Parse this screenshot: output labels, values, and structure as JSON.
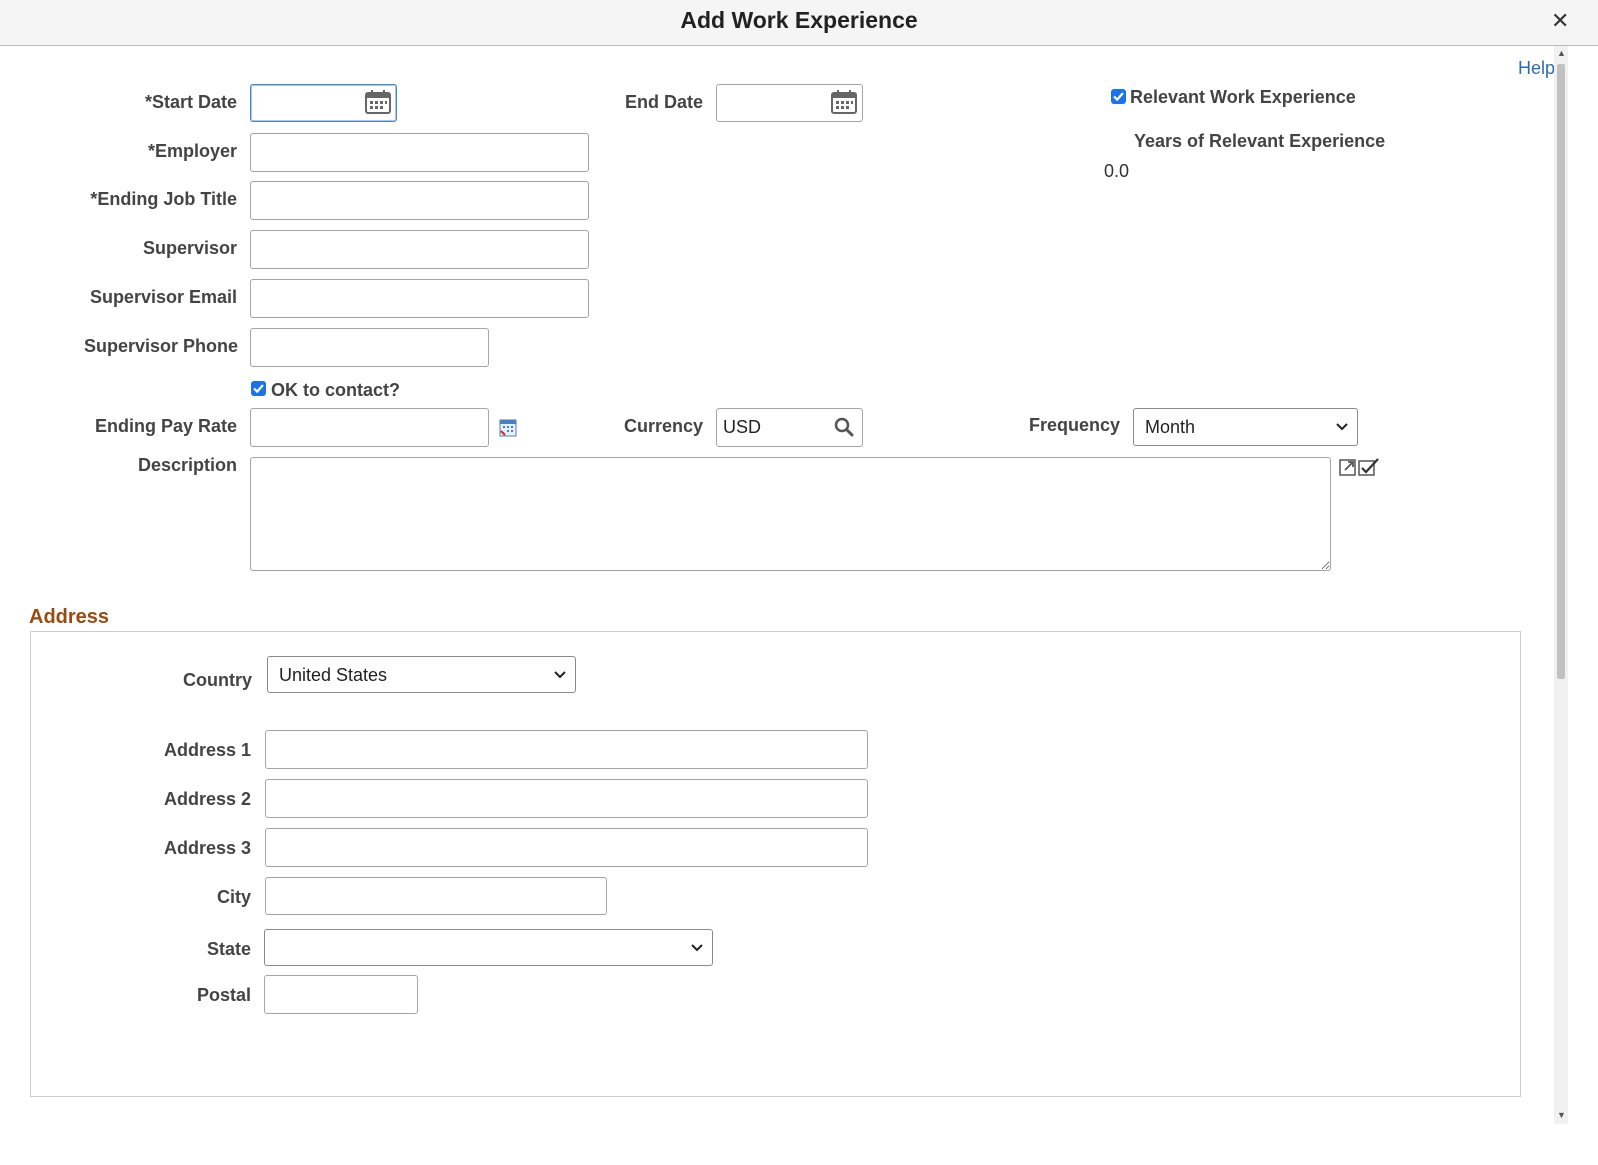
{
  "dialog": {
    "title": "Add Work Experience",
    "close": "✕",
    "help": "Help"
  },
  "labels": {
    "start_date": "*Start Date",
    "end_date": "End Date",
    "employer": "*Employer",
    "ending_job_title": "*Ending Job Title",
    "supervisor": "Supervisor",
    "supervisor_email": "Supervisor Email",
    "supervisor_phone": "Supervisor Phone",
    "ok_to_contact": "OK to contact?",
    "ending_pay_rate": "Ending Pay Rate",
    "currency": "Currency",
    "frequency": "Frequency",
    "description": "Description",
    "relevant_work_experience": "Relevant Work Experience",
    "years_relevant": "Years of Relevant Experience"
  },
  "values": {
    "start_date": "",
    "end_date": "",
    "employer": "",
    "ending_job_title": "",
    "supervisor": "",
    "supervisor_email": "",
    "supervisor_phone": "",
    "ending_pay_rate": "",
    "currency": "USD",
    "frequency": "Month",
    "description": "",
    "years_relevant": "0.0",
    "ok_to_contact_checked": true,
    "relevant_work_experience_checked": true
  },
  "address": {
    "section_title": "Address",
    "labels": {
      "country": "Country",
      "address1": "Address 1",
      "address2": "Address 2",
      "address3": "Address 3",
      "city": "City",
      "state": "State",
      "postal": "Postal"
    },
    "values": {
      "country": "United States",
      "address1": "",
      "address2": "",
      "address3": "",
      "city": "",
      "state": "",
      "postal": ""
    }
  },
  "icons": {
    "calendar": "calendar-icon",
    "search": "search-icon",
    "calculator": "calculator-icon",
    "spellcheck": "spellcheck-icon",
    "chevron": "chevron-down-icon"
  },
  "colors": {
    "accent": "#2b6cb0",
    "section_title": "#9a4b11",
    "checkbox": "#1a73e8"
  }
}
